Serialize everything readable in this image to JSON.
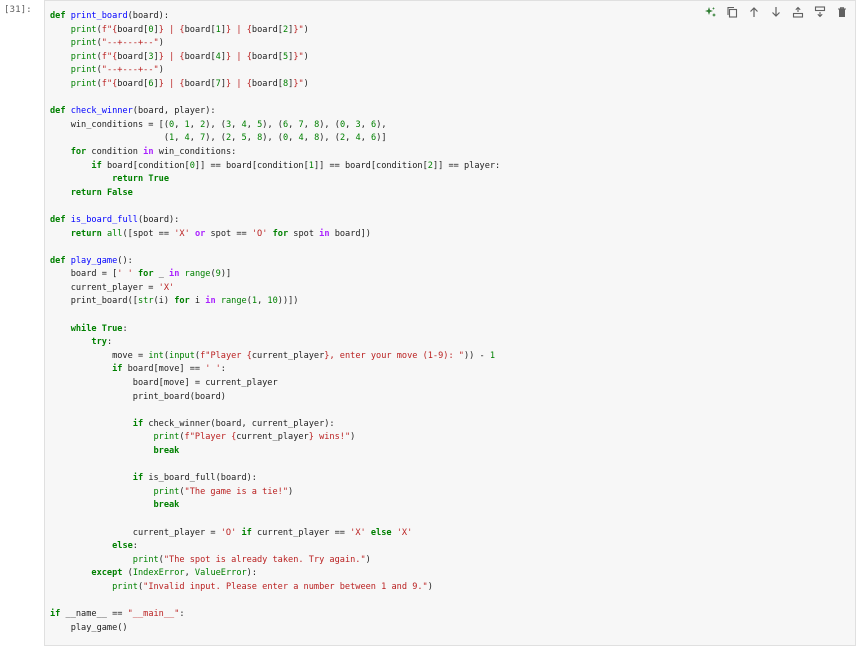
{
  "cell": {
    "prompt": "[31]:",
    "lines": [
      [
        [
          "kw",
          "def "
        ],
        [
          "fn",
          "print_board"
        ],
        [
          "t",
          "(board):"
        ]
      ],
      [
        [
          "t",
          "    "
        ],
        [
          "bi",
          "print"
        ],
        [
          "t",
          "("
        ],
        [
          "str",
          "f\"{"
        ],
        [
          "t",
          "board["
        ],
        [
          "num",
          "0"
        ],
        [
          "t",
          "]"
        ],
        [
          "str",
          "} | {"
        ],
        [
          "t",
          "board["
        ],
        [
          "num",
          "1"
        ],
        [
          "t",
          "]"
        ],
        [
          "str",
          "} | {"
        ],
        [
          "t",
          "board["
        ],
        [
          "num",
          "2"
        ],
        [
          "t",
          "]"
        ],
        [
          "str",
          "}\""
        ],
        [
          "t",
          ")"
        ]
      ],
      [
        [
          "t",
          "    "
        ],
        [
          "bi",
          "print"
        ],
        [
          "t",
          "("
        ],
        [
          "str",
          "\"--+---+--\""
        ],
        [
          "t",
          ")"
        ]
      ],
      [
        [
          "t",
          "    "
        ],
        [
          "bi",
          "print"
        ],
        [
          "t",
          "("
        ],
        [
          "str",
          "f\"{"
        ],
        [
          "t",
          "board["
        ],
        [
          "num",
          "3"
        ],
        [
          "t",
          "]"
        ],
        [
          "str",
          "} | {"
        ],
        [
          "t",
          "board["
        ],
        [
          "num",
          "4"
        ],
        [
          "t",
          "]"
        ],
        [
          "str",
          "} | {"
        ],
        [
          "t",
          "board["
        ],
        [
          "num",
          "5"
        ],
        [
          "t",
          "]"
        ],
        [
          "str",
          "}\""
        ],
        [
          "t",
          ")"
        ]
      ],
      [
        [
          "t",
          "    "
        ],
        [
          "bi",
          "print"
        ],
        [
          "t",
          "("
        ],
        [
          "str",
          "\"--+---+--\""
        ],
        [
          "t",
          ")"
        ]
      ],
      [
        [
          "t",
          "    "
        ],
        [
          "bi",
          "print"
        ],
        [
          "t",
          "("
        ],
        [
          "str",
          "f\"{"
        ],
        [
          "t",
          "board["
        ],
        [
          "num",
          "6"
        ],
        [
          "t",
          "]"
        ],
        [
          "str",
          "} | {"
        ],
        [
          "t",
          "board["
        ],
        [
          "num",
          "7"
        ],
        [
          "t",
          "]"
        ],
        [
          "str",
          "} | {"
        ],
        [
          "t",
          "board["
        ],
        [
          "num",
          "8"
        ],
        [
          "t",
          "]"
        ],
        [
          "str",
          "}\""
        ],
        [
          "t",
          ")"
        ]
      ],
      [
        [
          "t",
          ""
        ]
      ],
      [
        [
          "kw",
          "def "
        ],
        [
          "fn",
          "check_winner"
        ],
        [
          "t",
          "(board, player):"
        ]
      ],
      [
        [
          "t",
          "    win_conditions = [("
        ],
        [
          "num",
          "0"
        ],
        [
          "t",
          ", "
        ],
        [
          "num",
          "1"
        ],
        [
          "t",
          ", "
        ],
        [
          "num",
          "2"
        ],
        [
          "t",
          "), ("
        ],
        [
          "num",
          "3"
        ],
        [
          "t",
          ", "
        ],
        [
          "num",
          "4"
        ],
        [
          "t",
          ", "
        ],
        [
          "num",
          "5"
        ],
        [
          "t",
          "), ("
        ],
        [
          "num",
          "6"
        ],
        [
          "t",
          ", "
        ],
        [
          "num",
          "7"
        ],
        [
          "t",
          ", "
        ],
        [
          "num",
          "8"
        ],
        [
          "t",
          "), ("
        ],
        [
          "num",
          "0"
        ],
        [
          "t",
          ", "
        ],
        [
          "num",
          "3"
        ],
        [
          "t",
          ", "
        ],
        [
          "num",
          "6"
        ],
        [
          "t",
          "),"
        ]
      ],
      [
        [
          "t",
          "                      ("
        ],
        [
          "num",
          "1"
        ],
        [
          "t",
          ", "
        ],
        [
          "num",
          "4"
        ],
        [
          "t",
          ", "
        ],
        [
          "num",
          "7"
        ],
        [
          "t",
          "), ("
        ],
        [
          "num",
          "2"
        ],
        [
          "t",
          ", "
        ],
        [
          "num",
          "5"
        ],
        [
          "t",
          ", "
        ],
        [
          "num",
          "8"
        ],
        [
          "t",
          "), ("
        ],
        [
          "num",
          "0"
        ],
        [
          "t",
          ", "
        ],
        [
          "num",
          "4"
        ],
        [
          "t",
          ", "
        ],
        [
          "num",
          "8"
        ],
        [
          "t",
          "), ("
        ],
        [
          "num",
          "2"
        ],
        [
          "t",
          ", "
        ],
        [
          "num",
          "4"
        ],
        [
          "t",
          ", "
        ],
        [
          "num",
          "6"
        ],
        [
          "t",
          ")]"
        ]
      ],
      [
        [
          "t",
          "    "
        ],
        [
          "kw",
          "for"
        ],
        [
          "t",
          " condition "
        ],
        [
          "op",
          "in"
        ],
        [
          "t",
          " win_conditions:"
        ]
      ],
      [
        [
          "t",
          "        "
        ],
        [
          "kw",
          "if"
        ],
        [
          "t",
          " board[condition["
        ],
        [
          "num",
          "0"
        ],
        [
          "t",
          "]] == board[condition["
        ],
        [
          "num",
          "1"
        ],
        [
          "t",
          "]] == board[condition["
        ],
        [
          "num",
          "2"
        ],
        [
          "t",
          "]] == player:"
        ]
      ],
      [
        [
          "t",
          "            "
        ],
        [
          "kw",
          "return"
        ],
        [
          "t",
          " "
        ],
        [
          "kw",
          "True"
        ]
      ],
      [
        [
          "t",
          "    "
        ],
        [
          "kw",
          "return"
        ],
        [
          "t",
          " "
        ],
        [
          "kw",
          "False"
        ]
      ],
      [
        [
          "t",
          ""
        ]
      ],
      [
        [
          "kw",
          "def "
        ],
        [
          "fn",
          "is_board_full"
        ],
        [
          "t",
          "(board):"
        ]
      ],
      [
        [
          "t",
          "    "
        ],
        [
          "kw",
          "return"
        ],
        [
          "t",
          " "
        ],
        [
          "bi",
          "all"
        ],
        [
          "t",
          "([spot == "
        ],
        [
          "str",
          "'X'"
        ],
        [
          "t",
          " "
        ],
        [
          "op",
          "or"
        ],
        [
          "t",
          " spot == "
        ],
        [
          "str",
          "'O'"
        ],
        [
          "t",
          " "
        ],
        [
          "kw",
          "for"
        ],
        [
          "t",
          " spot "
        ],
        [
          "op",
          "in"
        ],
        [
          "t",
          " board])"
        ]
      ],
      [
        [
          "t",
          ""
        ]
      ],
      [
        [
          "kw",
          "def "
        ],
        [
          "fn",
          "play_game"
        ],
        [
          "t",
          "():"
        ]
      ],
      [
        [
          "t",
          "    board = ["
        ],
        [
          "str",
          "' '"
        ],
        [
          "t",
          " "
        ],
        [
          "kw",
          "for"
        ],
        [
          "t",
          " _ "
        ],
        [
          "op",
          "in"
        ],
        [
          "t",
          " "
        ],
        [
          "bi",
          "range"
        ],
        [
          "t",
          "("
        ],
        [
          "num",
          "9"
        ],
        [
          "t",
          ")]"
        ]
      ],
      [
        [
          "t",
          "    current_player = "
        ],
        [
          "str",
          "'X'"
        ]
      ],
      [
        [
          "t",
          "    print_board(["
        ],
        [
          "bi",
          "str"
        ],
        [
          "t",
          "(i) "
        ],
        [
          "kw",
          "for"
        ],
        [
          "t",
          " i "
        ],
        [
          "op",
          "in"
        ],
        [
          "t",
          " "
        ],
        [
          "bi",
          "range"
        ],
        [
          "t",
          "("
        ],
        [
          "num",
          "1"
        ],
        [
          "t",
          ", "
        ],
        [
          "num",
          "10"
        ],
        [
          "t",
          "))])"
        ]
      ],
      [
        [
          "t",
          ""
        ]
      ],
      [
        [
          "t",
          "    "
        ],
        [
          "kw",
          "while"
        ],
        [
          "t",
          " "
        ],
        [
          "kw",
          "True"
        ],
        [
          "t",
          ":"
        ]
      ],
      [
        [
          "t",
          "        "
        ],
        [
          "kw",
          "try"
        ],
        [
          "t",
          ":"
        ]
      ],
      [
        [
          "t",
          "            move = "
        ],
        [
          "bi",
          "int"
        ],
        [
          "t",
          "("
        ],
        [
          "bi",
          "input"
        ],
        [
          "t",
          "("
        ],
        [
          "str",
          "f\"Player {"
        ],
        [
          "t",
          "current_player"
        ],
        [
          "str",
          "}, enter your move (1-9): \""
        ],
        [
          "t",
          ")) - "
        ],
        [
          "num",
          "1"
        ]
      ],
      [
        [
          "t",
          "            "
        ],
        [
          "kw",
          "if"
        ],
        [
          "t",
          " board[move] == "
        ],
        [
          "str",
          "' '"
        ],
        [
          "t",
          ":"
        ]
      ],
      [
        [
          "t",
          "                board[move] = current_player"
        ]
      ],
      [
        [
          "t",
          "                print_board(board)"
        ]
      ],
      [
        [
          "t",
          ""
        ]
      ],
      [
        [
          "t",
          "                "
        ],
        [
          "kw",
          "if"
        ],
        [
          "t",
          " check_winner(board, current_player):"
        ]
      ],
      [
        [
          "t",
          "                    "
        ],
        [
          "bi",
          "print"
        ],
        [
          "t",
          "("
        ],
        [
          "str",
          "f\"Player {"
        ],
        [
          "t",
          "current_player"
        ],
        [
          "str",
          "} wins!\""
        ],
        [
          "t",
          ")"
        ]
      ],
      [
        [
          "t",
          "                    "
        ],
        [
          "kw",
          "break"
        ]
      ],
      [
        [
          "t",
          ""
        ]
      ],
      [
        [
          "t",
          "                "
        ],
        [
          "kw",
          "if"
        ],
        [
          "t",
          " is_board_full(board):"
        ]
      ],
      [
        [
          "t",
          "                    "
        ],
        [
          "bi",
          "print"
        ],
        [
          "t",
          "("
        ],
        [
          "str",
          "\"The game is a tie!\""
        ],
        [
          "t",
          ")"
        ]
      ],
      [
        [
          "t",
          "                    "
        ],
        [
          "kw",
          "break"
        ]
      ],
      [
        [
          "t",
          ""
        ]
      ],
      [
        [
          "t",
          "                current_player = "
        ],
        [
          "str",
          "'O'"
        ],
        [
          "t",
          " "
        ],
        [
          "kw",
          "if"
        ],
        [
          "t",
          " current_player == "
        ],
        [
          "str",
          "'X'"
        ],
        [
          "t",
          " "
        ],
        [
          "kw",
          "else"
        ],
        [
          "t",
          " "
        ],
        [
          "str",
          "'X'"
        ]
      ],
      [
        [
          "t",
          "            "
        ],
        [
          "kw",
          "else"
        ],
        [
          "t",
          ":"
        ]
      ],
      [
        [
          "t",
          "                "
        ],
        [
          "bi",
          "print"
        ],
        [
          "t",
          "("
        ],
        [
          "str",
          "\"The spot is already taken. Try again.\""
        ],
        [
          "t",
          ")"
        ]
      ],
      [
        [
          "t",
          "        "
        ],
        [
          "kw",
          "except"
        ],
        [
          "t",
          " ("
        ],
        [
          "bi",
          "IndexError"
        ],
        [
          "t",
          ", "
        ],
        [
          "bi",
          "ValueError"
        ],
        [
          "t",
          "):"
        ]
      ],
      [
        [
          "t",
          "            "
        ],
        [
          "bi",
          "print"
        ],
        [
          "t",
          "("
        ],
        [
          "str",
          "\"Invalid input. Please enter a number between 1 and 9.\""
        ],
        [
          "t",
          ")"
        ]
      ],
      [
        [
          "t",
          ""
        ]
      ],
      [
        [
          "kw",
          "if"
        ],
        [
          "t",
          " __name__ == "
        ],
        [
          "str",
          "\"__main__\""
        ],
        [
          "t",
          ":"
        ]
      ],
      [
        [
          "t",
          "    play_game()"
        ]
      ]
    ]
  },
  "toolbar": {
    "buttons": [
      {
        "name": "ai-sparkle-button",
        "icon": "sparkle-icon",
        "color": "#2e7d32"
      },
      {
        "name": "duplicate-cell-button",
        "icon": "copy-icon",
        "color": "#616161"
      },
      {
        "name": "move-up-button",
        "icon": "arrow-up-icon",
        "color": "#616161"
      },
      {
        "name": "move-down-button",
        "icon": "arrow-down-icon",
        "color": "#616161"
      },
      {
        "name": "insert-above-button",
        "icon": "insert-above-icon",
        "color": "#616161"
      },
      {
        "name": "insert-below-button",
        "icon": "insert-below-icon",
        "color": "#616161"
      },
      {
        "name": "delete-cell-button",
        "icon": "trash-icon",
        "color": "#616161"
      }
    ]
  }
}
